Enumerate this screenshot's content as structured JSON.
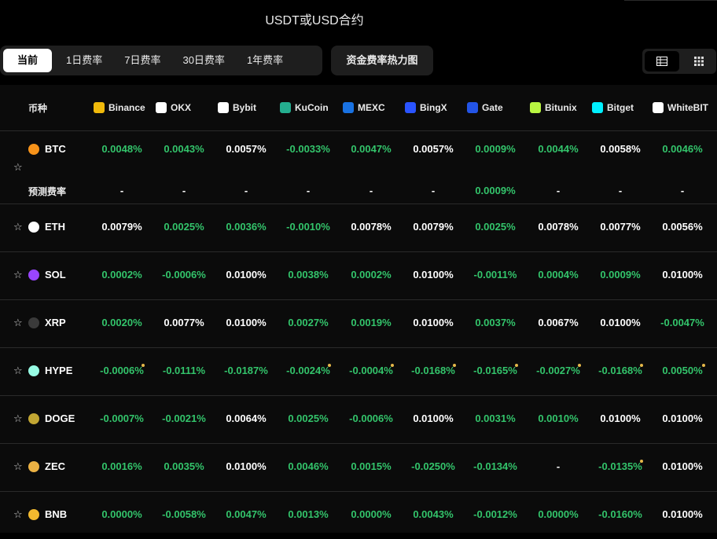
{
  "header": {
    "title": "USDT或USD合约"
  },
  "tabs": [
    {
      "label": "当前",
      "active": true
    },
    {
      "label": "1日费率"
    },
    {
      "label": "7日费率"
    },
    {
      "label": "30日费率"
    },
    {
      "label": "1年费率"
    }
  ],
  "heatmap_button": "资金费率热力图",
  "view_toggle": {
    "selected": "table-view-icon",
    "other": "grid-view-icon"
  },
  "table": {
    "coin_header": "币种",
    "exchanges": [
      {
        "name": "Binance",
        "color": "#f0b90b",
        "icon": "binance-logo"
      },
      {
        "name": "OKX",
        "color": "#ffffff",
        "icon": "okx-logo"
      },
      {
        "name": "Bybit",
        "color": "#ffffff",
        "icon": "bybit-logo"
      },
      {
        "name": "KuCoin",
        "color": "#24ae8f",
        "icon": "kucoin-logo"
      },
      {
        "name": "MEXC",
        "color": "#1972e2",
        "icon": "mexc-logo"
      },
      {
        "name": "BingX",
        "color": "#2a54ff",
        "icon": "bingx-logo"
      },
      {
        "name": "Gate",
        "color": "#2354e6",
        "icon": "gate-logo"
      },
      {
        "name": "Bitunix",
        "color": "#b9f641",
        "icon": "bitunix-logo"
      },
      {
        "name": "Bitget",
        "color": "#00f0ff",
        "icon": "bitget-logo"
      },
      {
        "name": "WhiteBIT",
        "color": "#ffffff",
        "icon": "whitebit-logo"
      }
    ],
    "predicted_label": "预测费率",
    "rows": [
      {
        "coin": "BTC",
        "icon_color": "#f7931a",
        "rates": [
          "0.0048%",
          "0.0043%",
          "0.0057%",
          "-0.0033%",
          "0.0047%",
          "0.0057%",
          "0.0009%",
          "0.0044%",
          "0.0058%",
          "0.0046%"
        ],
        "colors": [
          "g",
          "g",
          "w",
          "g",
          "g",
          "w",
          "g",
          "g",
          "w",
          "g"
        ],
        "predicted": [
          "-",
          "-",
          "-",
          "-",
          "-",
          "-",
          "0.0009%",
          "-",
          "-",
          "-"
        ],
        "predicted_colors": [
          "w",
          "w",
          "w",
          "w",
          "w",
          "w",
          "g",
          "w",
          "w",
          "w"
        ]
      },
      {
        "coin": "ETH",
        "icon_color": "#ffffff",
        "rates": [
          "0.0079%",
          "0.0025%",
          "0.0036%",
          "-0.0010%",
          "0.0078%",
          "0.0079%",
          "0.0025%",
          "0.0078%",
          "0.0077%",
          "0.0056%"
        ],
        "colors": [
          "w",
          "g",
          "g",
          "g",
          "w",
          "w",
          "g",
          "w",
          "w",
          "w"
        ]
      },
      {
        "coin": "SOL",
        "icon_color": "#9945ff",
        "rates": [
          "0.0002%",
          "-0.0006%",
          "0.0100%",
          "0.0038%",
          "0.0002%",
          "0.0100%",
          "-0.0011%",
          "0.0004%",
          "0.0009%",
          "0.0100%"
        ],
        "colors": [
          "g",
          "g",
          "w",
          "g",
          "g",
          "w",
          "g",
          "g",
          "g",
          "w"
        ]
      },
      {
        "coin": "XRP",
        "icon_color": "#3a3a3a",
        "rates": [
          "0.0020%",
          "0.0077%",
          "0.0100%",
          "0.0027%",
          "0.0019%",
          "0.0100%",
          "0.0037%",
          "0.0067%",
          "0.0100%",
          "-0.0047%"
        ],
        "colors": [
          "g",
          "w",
          "w",
          "g",
          "g",
          "w",
          "g",
          "w",
          "w",
          "g"
        ]
      },
      {
        "coin": "HYPE",
        "icon_color": "#97fce4",
        "rates": [
          "-0.0006%",
          "-0.0111%",
          "-0.0187%",
          "-0.0024%",
          "-0.0004%",
          "-0.0168%",
          "-0.0165%",
          "-0.0027%",
          "-0.0168%",
          "0.0050%"
        ],
        "colors": [
          "g",
          "g",
          "g",
          "g",
          "g",
          "g",
          "g",
          "g",
          "g",
          "g"
        ],
        "marks": [
          true,
          false,
          false,
          true,
          true,
          true,
          true,
          true,
          true,
          true
        ]
      },
      {
        "coin": "DOGE",
        "icon_color": "#c2a633",
        "rates": [
          "-0.0007%",
          "-0.0021%",
          "0.0064%",
          "0.0025%",
          "-0.0006%",
          "0.0100%",
          "0.0031%",
          "0.0010%",
          "0.0100%",
          "0.0100%"
        ],
        "colors": [
          "g",
          "g",
          "w",
          "g",
          "g",
          "w",
          "g",
          "g",
          "w",
          "w"
        ]
      },
      {
        "coin": "ZEC",
        "icon_color": "#ecb244",
        "rates": [
          "0.0016%",
          "0.0035%",
          "0.0100%",
          "0.0046%",
          "0.0015%",
          "-0.0250%",
          "-0.0134%",
          "-",
          "-0.0135%",
          "0.0100%"
        ],
        "colors": [
          "g",
          "g",
          "w",
          "g",
          "g",
          "g",
          "g",
          "w",
          "g",
          "w"
        ],
        "marks": [
          false,
          false,
          false,
          false,
          false,
          false,
          false,
          false,
          true,
          false
        ]
      },
      {
        "coin": "BNB",
        "icon_color": "#f3ba2f",
        "rates": [
          "0.0000%",
          "-0.0058%",
          "0.0047%",
          "0.0013%",
          "0.0000%",
          "0.0043%",
          "-0.0012%",
          "0.0000%",
          "-0.0160%",
          "0.0100%"
        ],
        "colors": [
          "g",
          "g",
          "g",
          "g",
          "g",
          "g",
          "g",
          "g",
          "g",
          "w"
        ]
      }
    ]
  }
}
